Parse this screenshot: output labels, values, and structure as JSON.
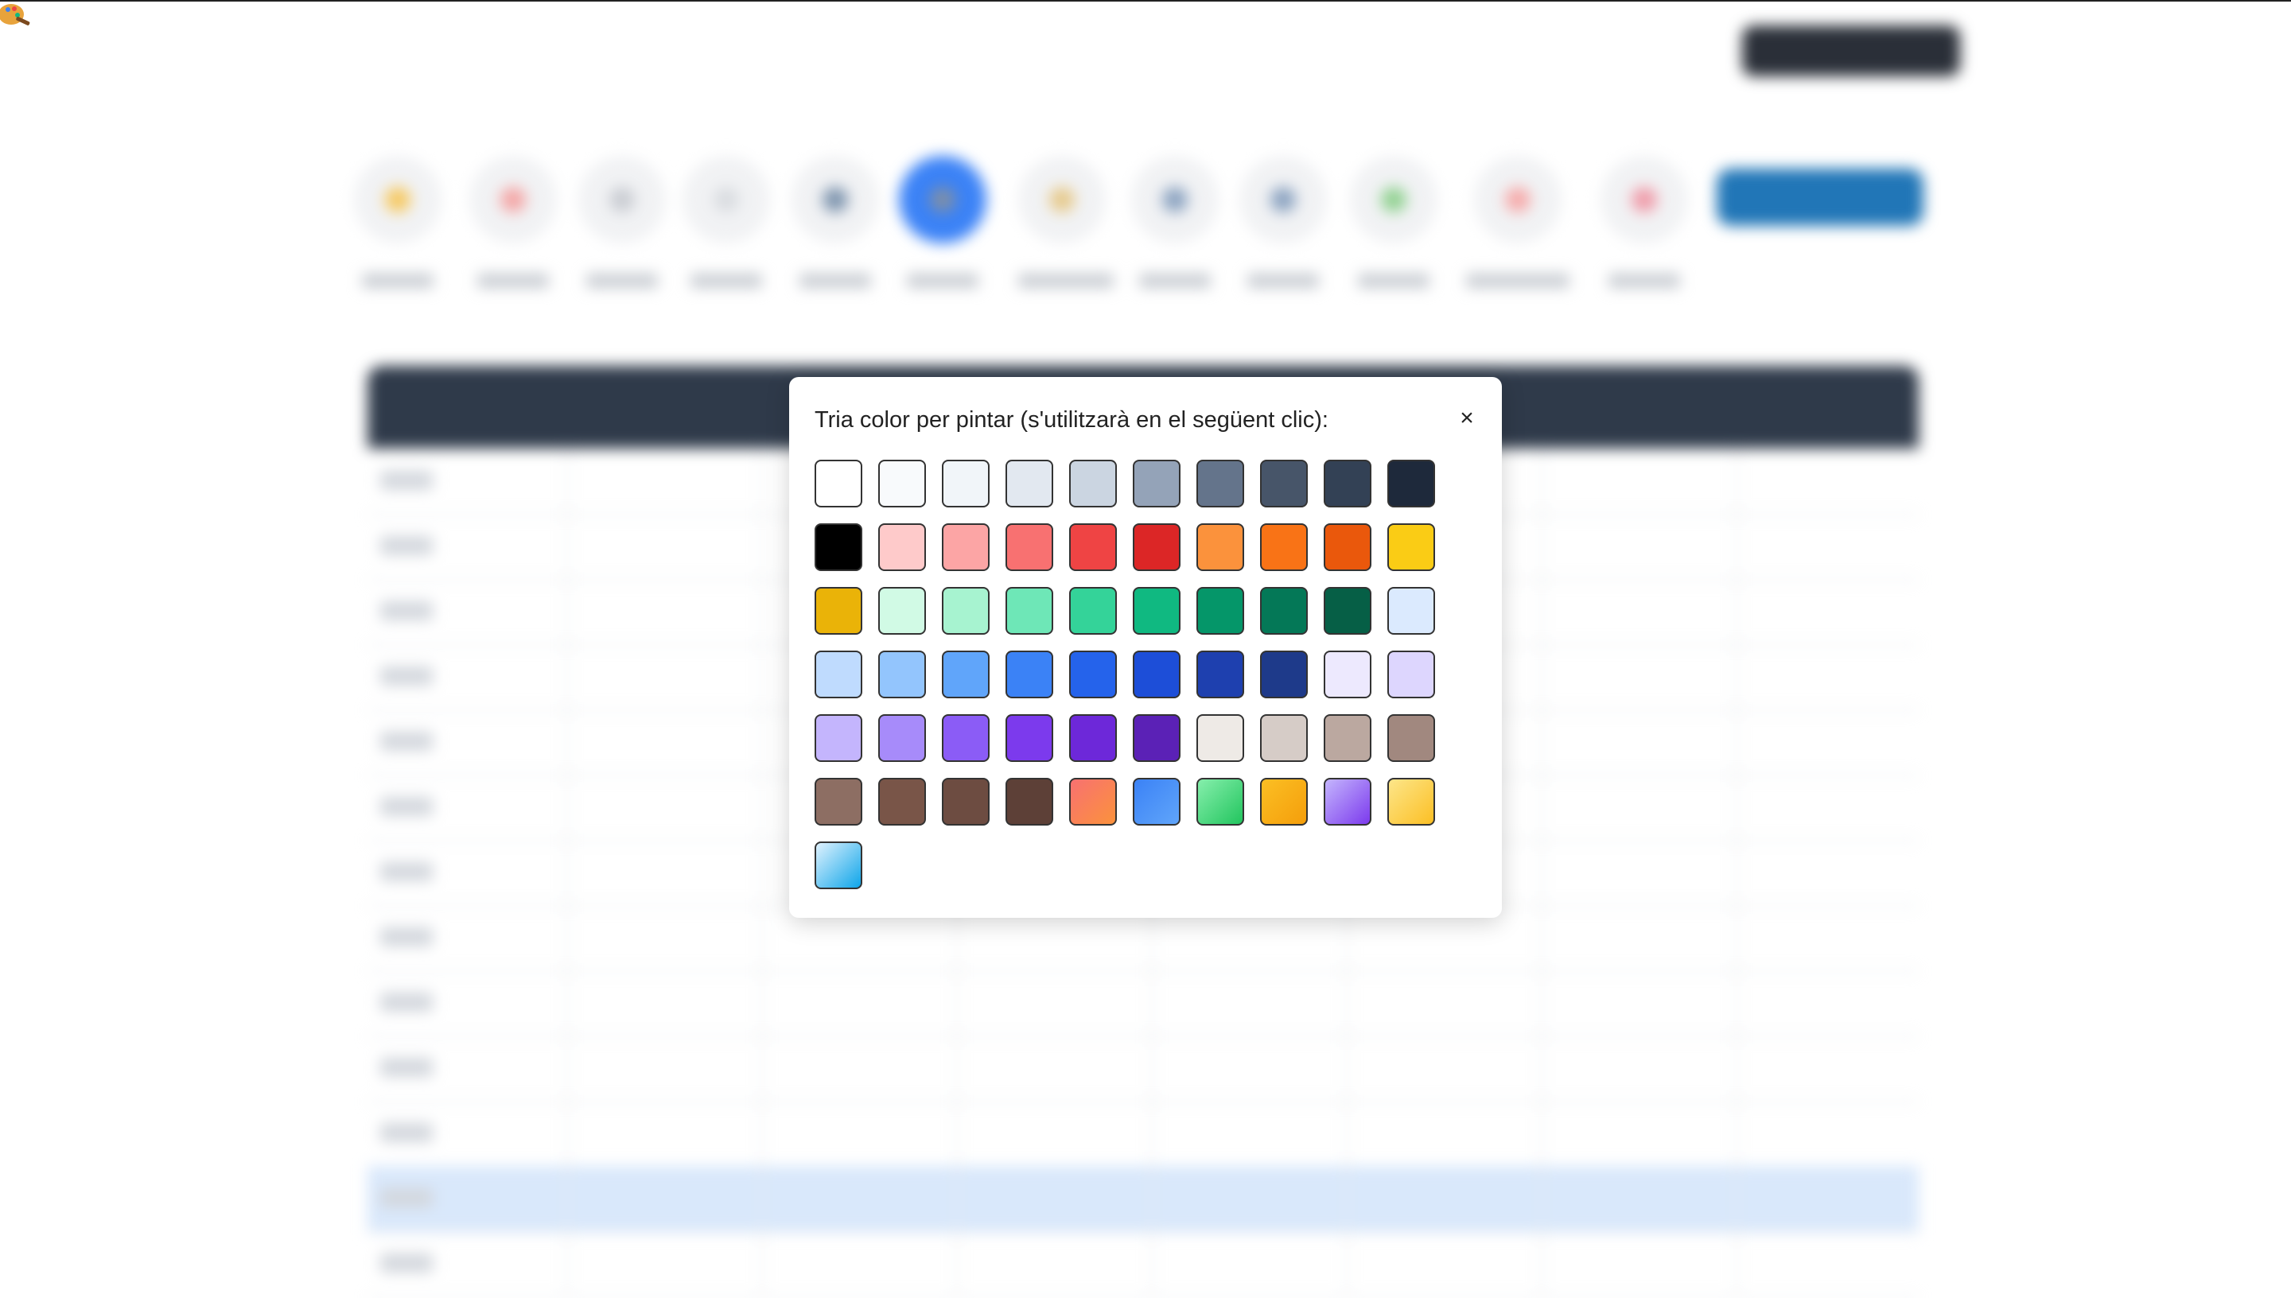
{
  "modal": {
    "title": "Tria color per pintar (s'utilitzarà en el següent clic):",
    "close_label": "×"
  },
  "palette": [
    "#ffffff",
    "#f8fafc",
    "#f1f5f9",
    "#e2e8f0",
    "#cbd5e1",
    "#94a3b8",
    "#64748b",
    "#475569",
    "#334155",
    "#1e293b",
    "#000000",
    "#fecaca",
    "#fca5a5",
    "#f87171",
    "#ef4444",
    "#dc2626",
    "#fb923c",
    "#f97316",
    "#ea580c",
    "#facc15",
    "#eab308",
    "#d1fae5",
    "#a7f3d0",
    "#6ee7b7",
    "#34d399",
    "#10b981",
    "#059669",
    "#047857",
    "#065f46",
    "#dbeafe",
    "#bfdbfe",
    "#93c5fd",
    "#60a5fa",
    "#3b82f6",
    "#2563eb",
    "#1d4ed8",
    "#1e40af",
    "#1e3a8a",
    "#ede9fe",
    "#ddd6fe",
    "#c4b5fd",
    "#a78bfa",
    "#8b5cf6",
    "#7c3aed",
    "#6d28d9",
    "#5b21b6",
    "#eeeae6",
    "#d6ccc7",
    "#bba8a0",
    "#a1887f",
    "#8d6e63",
    "#795548",
    "#6d4c41",
    "#5d4037",
    "linear-gradient(135deg, #f87171, #fb923c)",
    "linear-gradient(135deg, #3b82f6, #60a5fa)",
    "linear-gradient(135deg, #86efac, #22c55e)",
    "linear-gradient(135deg, #fbbf24, #f59e0b)",
    "linear-gradient(135deg, #c4b5fd, #7c3aed)",
    "linear-gradient(135deg, #fde68a, #fbbf24)",
    "linear-gradient(135deg, #e0f2fe, #0ea5e9)"
  ]
}
